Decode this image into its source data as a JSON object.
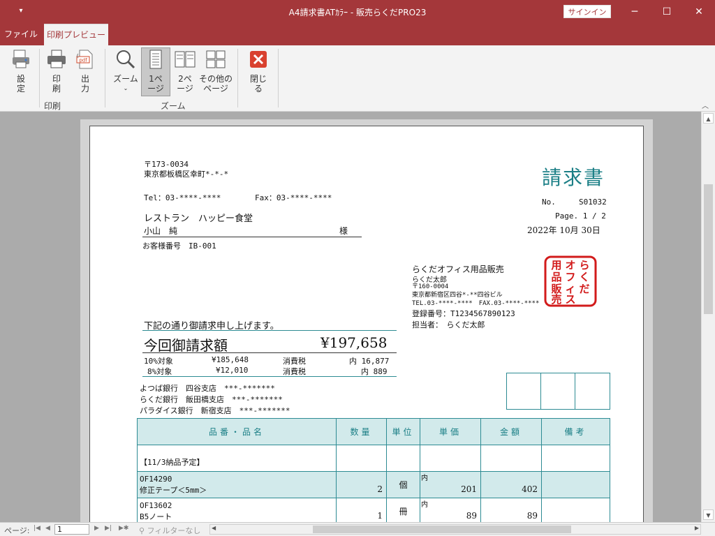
{
  "window": {
    "title": "A4請求書ATｶﾗｰ  -  販売らくだPRO23",
    "signin": "サインイン",
    "minimize": "─",
    "maximize": "☐",
    "close": "✕"
  },
  "tabs": [
    {
      "label": "ファイル"
    },
    {
      "label": "印刷プレビュー"
    }
  ],
  "ribbon": {
    "setup": "設定",
    "print": "印刷",
    "output": "出力",
    "zoom": "ズーム",
    "one_page": "1ページ",
    "two_pages": "2ページ",
    "other_pages": "その他のページ",
    "close": "閉じる",
    "group_print": "印刷",
    "group_zoom": "ズーム",
    "pdf_label": "pdf"
  },
  "invoice": {
    "postal": "〒173-0034",
    "address": "東京都板橋区幸町*-*-*",
    "tel": "Tel：03-****-****",
    "fax": "Fax：03-****-****",
    "doc_title": "請求書",
    "no_label": "No.",
    "no_value": "S01032",
    "page_label": "Page. 1 / 2",
    "date": "2022年 10月 30日",
    "customer_name": "レストラン　ハッピー食堂",
    "contact": "小山　純",
    "honorific": "様",
    "customer_no": "お客様番号　IB-001",
    "seller": {
      "company": "らくだオフィス用品販売",
      "person": "らくだ太郎",
      "postal": "〒160-0004",
      "address": "東京都新宿区四谷*-**四谷ビル",
      "telfax": "TEL.03-****-****　FAX.03-****-****",
      "reg_no": "登録番号：T1234567890123",
      "rep": "担当者：　らくだ太郎"
    },
    "seal_text": "らくだオフィス用品販売",
    "notice": "下記の通り御請求申し上げます。",
    "total_label": "今回御請求額",
    "total": "¥197,658",
    "tax10_label": "10%対象",
    "tax10_amount": "¥185,648",
    "tax10_tax_label": "消費税",
    "tax10_tax": "内 16,877",
    "tax8_label": "8%対象",
    "tax8_amount": "¥12,010",
    "tax8_tax_label": "消費税",
    "tax8_tax": "内 889",
    "banks": [
      "よつば銀行　四谷支店　***-*******",
      "らくだ銀行　飯田橋支店　***-*******",
      "パラダイス銀行　新宿支店　***-*******"
    ],
    "columns": [
      "品番・品名",
      "数量",
      "単位",
      "単価",
      "金額",
      "備考"
    ],
    "group_label": "【11/3納品予定】",
    "rows": [
      {
        "code": "OF14290",
        "name": "修正テープ＜5mm＞",
        "qty": "2",
        "unit": "個",
        "tax_mark": "内",
        "price": "201",
        "amount": "402",
        "note": ""
      },
      {
        "code": "OF13602",
        "name": "B5ノート",
        "qty": "1",
        "unit": "冊",
        "tax_mark": "内",
        "price": "89",
        "amount": "89",
        "note": ""
      }
    ]
  },
  "status": {
    "page_label": "ページ:",
    "page_value": "1",
    "filter": "フィルターなし"
  }
}
